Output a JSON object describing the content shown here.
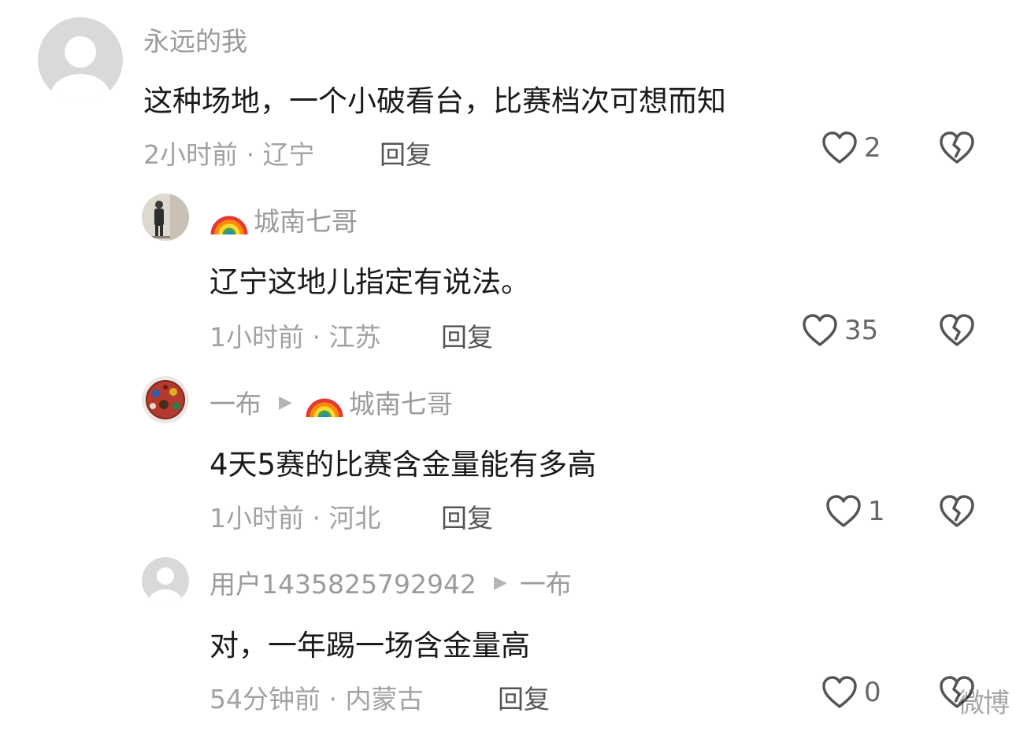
{
  "comments": [
    {
      "username": "永远的我",
      "reply_to": "",
      "text": "这种场地，一个小破看台，比赛档次可想而知",
      "time": "2小时前",
      "location": "辽宁",
      "reply_label": "回复",
      "likes": "2",
      "avatar": "default-avatar"
    },
    {
      "username": "城南七哥",
      "reply_to": "",
      "text": "辽宁这地儿指定有说法。",
      "time": "1小时前",
      "location": "江苏",
      "reply_label": "回复",
      "likes": "35",
      "avatar": "photo-avatar"
    },
    {
      "username": "一布",
      "reply_to": "城南七哥",
      "text": "4天5赛的比赛含金量能有多高",
      "time": "1小时前",
      "location": "河北",
      "reply_label": "回复",
      "likes": "1",
      "avatar": "crowd-avatar"
    },
    {
      "username": "用户1435825792942",
      "reply_to": "一布",
      "text": "对，一年踢一场含金量高",
      "time": "54分钟前",
      "location": "内蒙古",
      "reply_label": "回复",
      "likes": "0",
      "avatar": "default-avatar"
    }
  ],
  "separator": "·",
  "watermark": "微博",
  "icons": {
    "like": "heart-outline-icon",
    "dislike": "broken-heart-icon",
    "reply_arrow": "triangle-right-icon",
    "badge": "rainbow-icon"
  },
  "colors": {
    "username": "#9b9b9b",
    "text": "#1b1b1b",
    "meta": "#a2a2a2"
  }
}
